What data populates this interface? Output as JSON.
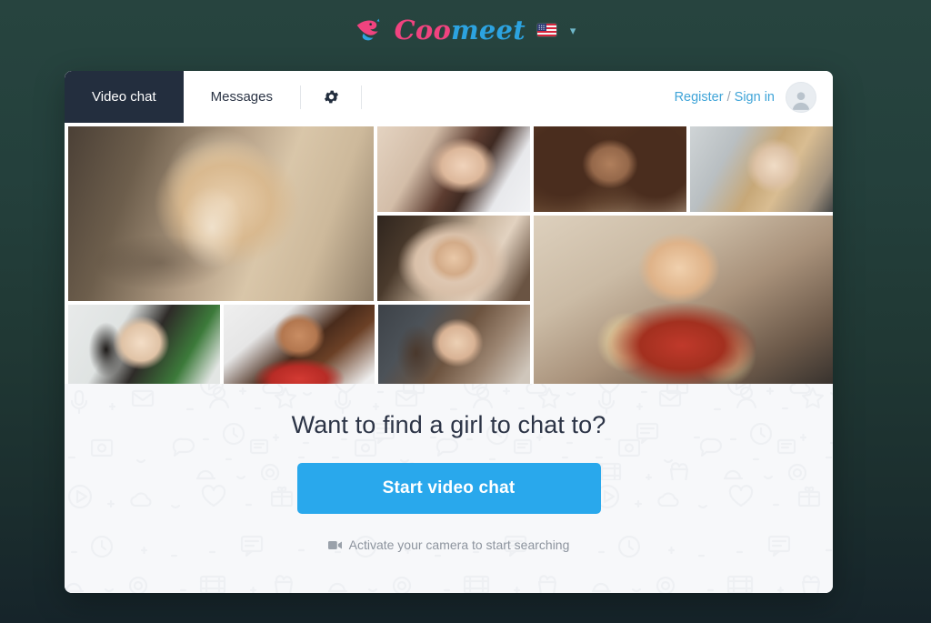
{
  "brand": {
    "name_part1": "Coo",
    "name_part2": "meet",
    "bird_icon": "bird-icon",
    "flag_icon": "us-flag-icon",
    "lang_caret": "∨",
    "color_pink": "#f0437f",
    "color_blue": "#2ca3e0"
  },
  "tabs": [
    {
      "label": "Video chat",
      "active": true
    },
    {
      "label": "Messages",
      "active": false
    }
  ],
  "toolbar": {
    "settings_icon": "gear-icon",
    "auth_register": "Register",
    "auth_separator": " / ",
    "auth_signin": "Sign in",
    "avatar_icon": "default-avatar-icon"
  },
  "gallery": {
    "tiles": [
      {
        "id": "tile-1",
        "alt": "blonde woman in bedroom",
        "style": "ph-blonde"
      },
      {
        "id": "tile-2",
        "alt": "brunette woman in white robe",
        "style": "ph-rb"
      },
      {
        "id": "tile-3",
        "alt": "woman with curly hair",
        "style": "ph-curly"
      },
      {
        "id": "tile-4",
        "alt": "blonde woman in black top",
        "style": "ph-blonde2"
      },
      {
        "id": "tile-5",
        "alt": "woman wearing beige hijab",
        "style": "ph-hijab"
      },
      {
        "id": "tile-6",
        "alt": "smiling woman in red floral blouse",
        "style": "ph-red"
      },
      {
        "id": "tile-7",
        "alt": "woman with dark hair and cactus",
        "style": "ph-asian"
      },
      {
        "id": "tile-8",
        "alt": "smiling woman in red shirt",
        "style": "ph-smile"
      },
      {
        "id": "tile-9",
        "alt": "smiling brunette woman",
        "style": "ph-brun"
      }
    ]
  },
  "hero": {
    "title": "Want to find a girl to chat to?",
    "cta_label": "Start video chat",
    "hint_icon": "video-camera-icon",
    "hint_text": "Activate your camera to start searching",
    "cta_color": "#29a8ec"
  },
  "theme": {
    "page_background": "#22403c",
    "card_background": "#ffffff",
    "active_tab_background": "#232e3e",
    "hero_background": "#f7f8fa",
    "link_color": "#3fa4d8"
  }
}
